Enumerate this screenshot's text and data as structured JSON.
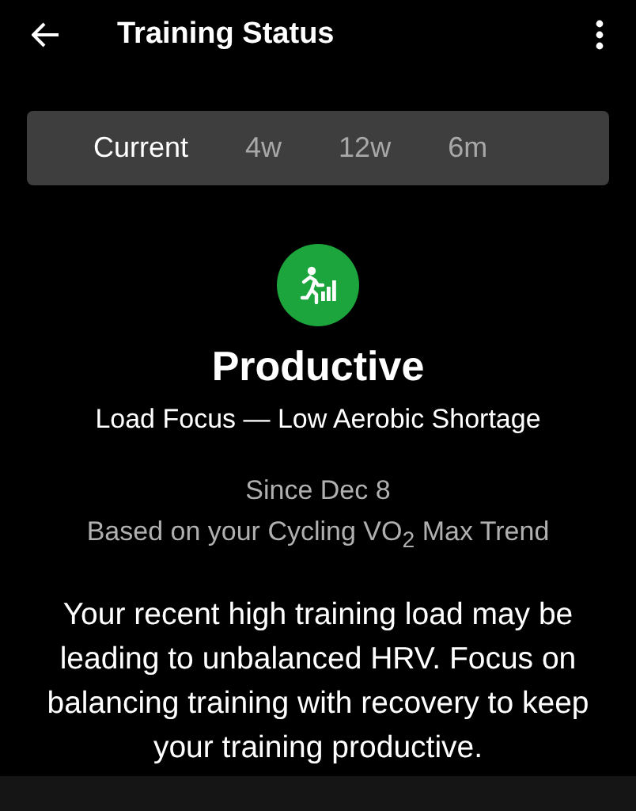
{
  "header": {
    "title": "Training Status"
  },
  "tabs": [
    {
      "label": "Current",
      "selected": true
    },
    {
      "label": "4w",
      "selected": false
    },
    {
      "label": "12w",
      "selected": false
    },
    {
      "label": "6m",
      "selected": false
    }
  ],
  "status": {
    "color": "#1ba53c",
    "label": "Productive",
    "focus": "Load Focus — Low Aerobic Shortage",
    "since": "Since Dec 8",
    "basis": "Based on your Cycling VO$_{2}$ Max Trend",
    "message": "Your recent high training load may be leading to unbalanced HRV. Focus on balancing training with recovery to keep your training productive."
  }
}
